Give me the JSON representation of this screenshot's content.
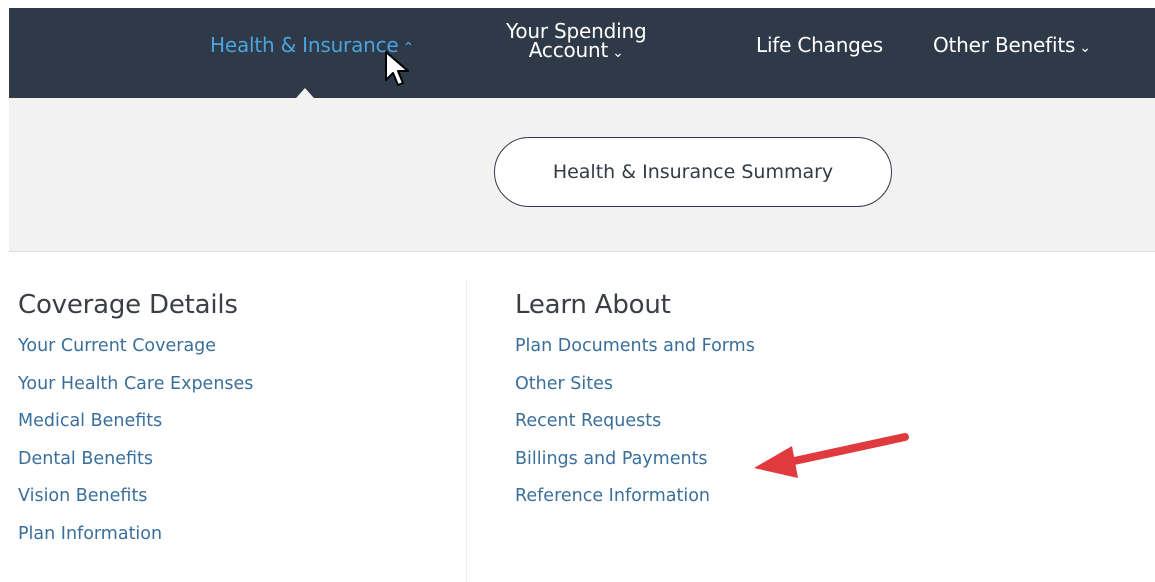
{
  "nav": {
    "health_label": "Health & Insurance",
    "health_chevron": "⌃",
    "spending_line1": "Your Spending",
    "spending_line2": "Account",
    "spending_chevron": "⌄",
    "life_label": "Life Changes",
    "other_label": "Other Benefits",
    "other_chevron": "⌄"
  },
  "summary": {
    "button_label": "Health & Insurance Summary"
  },
  "coverage": {
    "heading": "Coverage Details",
    "links": [
      "Your Current Coverage",
      "Your Health Care Expenses",
      "Medical Benefits",
      "Dental Benefits",
      "Vision Benefits",
      "Plan Information"
    ]
  },
  "learn": {
    "heading": "Learn About",
    "links": [
      "Plan Documents and Forms",
      "Other Sites",
      "Recent Requests",
      "Billings and Payments",
      "Reference Information"
    ]
  },
  "colors": {
    "nav_background": "#2f3a48",
    "active_nav": "#4aa3df",
    "link": "#3a6f9c",
    "annotation_arrow": "#e03a3e"
  },
  "icons": [
    "cursor-arrow-icon",
    "annotation-arrow-icon",
    "chevron-up-icon",
    "chevron-down-icon"
  ]
}
